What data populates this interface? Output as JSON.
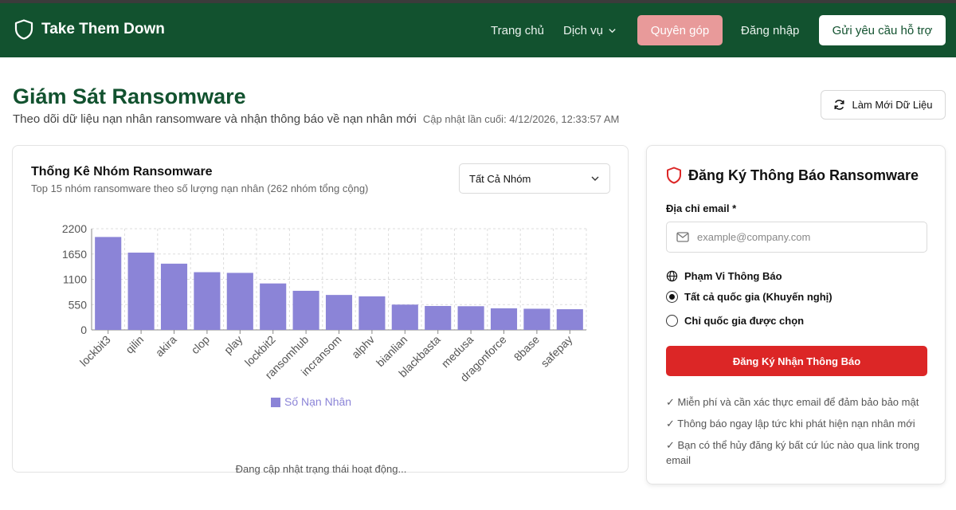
{
  "nav": {
    "brand": "Take Them Down",
    "home": "Trang chủ",
    "services": "Dịch vụ",
    "donate": "Quyên góp",
    "login": "Đăng nhập",
    "support": "Gửi yêu cầu hỗ trợ"
  },
  "header": {
    "title": "Giám Sát Ransomware",
    "subtitle": "Theo dõi dữ liệu nạn nhân ransomware và nhận thông báo về nạn nhân mới",
    "updated": "Cập nhật lần cuối: 4/12/2026, 12:33:57 AM",
    "refresh_label": "Làm Mới Dữ Liệu"
  },
  "chart_card": {
    "title": "Thống Kê Nhóm Ransomware",
    "subtitle": "Top 15 nhóm ransomware theo số lượng nạn nhân (262 nhóm tổng cộng)",
    "select_value": "Tất Cả Nhóm",
    "status": "Đang cập nhật trạng thái hoạt động..."
  },
  "chart_data": {
    "type": "bar",
    "categories": [
      "lockbit3",
      "qilin",
      "akira",
      "clop",
      "play",
      "lockbit2",
      "ransomhub",
      "incransom",
      "alphv",
      "bianlian",
      "blackbasta",
      "medusa",
      "dragonforce",
      "8base",
      "safepay"
    ],
    "series": [
      {
        "name": "Số Nạn Nhân",
        "values": [
          2020,
          1680,
          1440,
          1255,
          1240,
          1010,
          850,
          760,
          730,
          550,
          520,
          515,
          470,
          460,
          450
        ],
        "color": "#8b84d7"
      }
    ],
    "yticks": [
      "2200",
      "1650",
      "1100",
      "550",
      "0"
    ],
    "ylim": [
      0,
      2200
    ],
    "grid": true,
    "legend": "bottom"
  },
  "form": {
    "title": "Đăng Ký Thông Báo Ransomware",
    "email_label": "Địa chỉ email *",
    "email_placeholder": "example@company.com",
    "scope_label": "Phạm Vi Thông Báo",
    "option_all": "Tất cả quốc gia (Khuyến nghị)",
    "option_selected": "Chỉ quốc gia được chọn",
    "submit": "Đăng Ký Nhận Thông Báo",
    "notes": [
      "✓ Miễn phí và cần xác thực email để đảm bảo bảo mật",
      "✓ Thông báo ngay lập tức khi phát hiện nạn nhân mới",
      "✓ Bạn có thể hủy đăng ký bất cứ lúc nào qua link trong email"
    ]
  },
  "colors": {
    "brand_green": "#12522f",
    "donate": "#e89a9a",
    "bar": "#8b84d7",
    "submit": "#dc2626"
  }
}
